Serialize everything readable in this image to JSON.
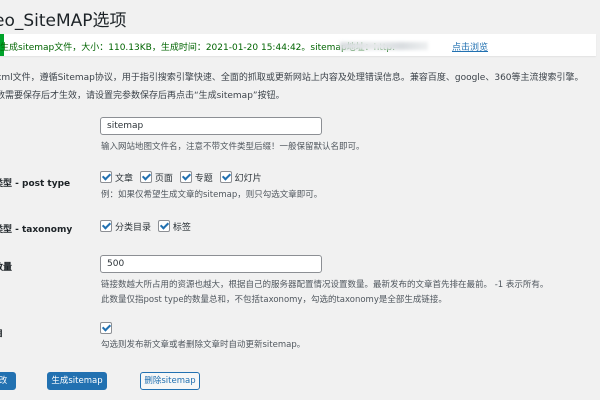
{
  "page": {
    "title": "eo_SiteMAP选项"
  },
  "notice": {
    "message": "生成sitemap文件，大小：110.13KB，生成时间：2021-01-20 15:44:42。sitemap地址：http:",
    "link_label": "点击浏览"
  },
  "intro": {
    "line1": "xml文件，遵循Sitemap协议，用于指引搜索引擎快速、全面的抓取或更新网站上内容及处理错误信息。兼容百度、google、360等主流搜索引擎。",
    "line2": "数需要保存后才生效，请设置完参数保存后再点击“生成sitemap”按钮。"
  },
  "fields": {
    "filename": {
      "value": "sitemap",
      "hint": "输入网站地图文件名，注意不带文件类型后缀！一般保留默认名即可。"
    },
    "post_type": {
      "label": "类型 - post type",
      "options": [
        {
          "label": "文章",
          "checked": true
        },
        {
          "label": "页面",
          "checked": true
        },
        {
          "label": "专题",
          "checked": true
        },
        {
          "label": "幻灯片",
          "checked": true
        }
      ],
      "hint": "例：如果仅希望生成文章的sitemap，则只勾选文章即可。"
    },
    "taxonomy": {
      "label": "类型 - taxonomy",
      "options": [
        {
          "label": "分类目录",
          "checked": true
        },
        {
          "label": "标签",
          "checked": true
        }
      ]
    },
    "count": {
      "label": "数量",
      "value": "500",
      "hint1": "链接数越大所占用的资源也越大，根据自己的服务器配置情况设置数量。最新发布的文章首先排在最前。 -1 表示所有。",
      "hint2": "此数量仅指post type的数量总和，不包括taxonomy，勾选的taxonomy是全部生成链接。"
    },
    "auto": {
      "label": "自",
      "checked": true,
      "hint": "勾选则发布新文章或者删除文章时自动更新sitemap。"
    }
  },
  "buttons": {
    "save_label": "改",
    "generate_label": "生成sitemap",
    "delete_label": "删除sitemap"
  }
}
